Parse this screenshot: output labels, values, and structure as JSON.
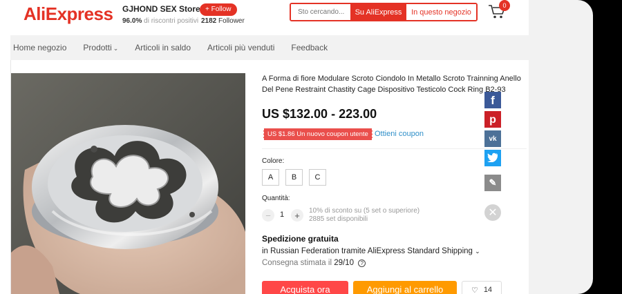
{
  "header": {
    "logo": "AliExpress",
    "store_name": "GJHOND SEX Store",
    "follow_label": "+ Follow",
    "rating_value": "96.0%",
    "rating_text": "di riscontri positivi",
    "followers_count": "2182",
    "followers_label": "Follower",
    "search_placeholder": "Sto cercando...",
    "search_all_label": "Su AliExpress",
    "search_store_label": "In questo negozio",
    "cart_count": "0"
  },
  "nav": {
    "items": [
      "Home negozio",
      "Prodotti",
      "Articoli in saldo",
      "Articoli più venduti",
      "Feedback"
    ]
  },
  "product": {
    "title": "A Forma di fiore Modulare Scroto Ciondolo In Metallo Scroto Trainning Anello Del Pene Restraint Chastity Cage Dispositivo Testicolo Cock Ring B2-93",
    "price": "US $132.00 - 223.00",
    "coupon_tag": "US $1.86 Un nuovo coupon utente",
    "coupon_link": "Ottieni coupon",
    "color_label": "Colore:",
    "variants": [
      "A",
      "B",
      "C"
    ],
    "quantity_label": "Quantità:",
    "quantity_value": "1",
    "quantity_discount": "10% di sconto su (5 set o superiore)",
    "quantity_available": "2885 set disponibili",
    "shipping_title": "Spedizione gratuita",
    "shipping_route": "in Russian Federation tramite AliExpress Standard Shipping",
    "shipping_eta_label": "Consegna stimata il",
    "shipping_eta_date": "29/10",
    "buy_label": "Acquista ora",
    "add_cart_label": "Aggiungi al carrello",
    "wishlist_count": "14"
  },
  "share": {
    "icons": [
      "facebook-icon",
      "pinterest-icon",
      "vk-icon",
      "twitter-icon",
      "pencil-icon",
      "close-icon"
    ]
  },
  "colors": {
    "brand": "#e43225",
    "coupon": "#ea4f4c",
    "buy": "#ff4747",
    "cart": "#ff9a00",
    "facebook": "#3b5998",
    "pinterest": "#cb2027",
    "vk": "#4d7198",
    "twitter": "#1da1f2"
  }
}
